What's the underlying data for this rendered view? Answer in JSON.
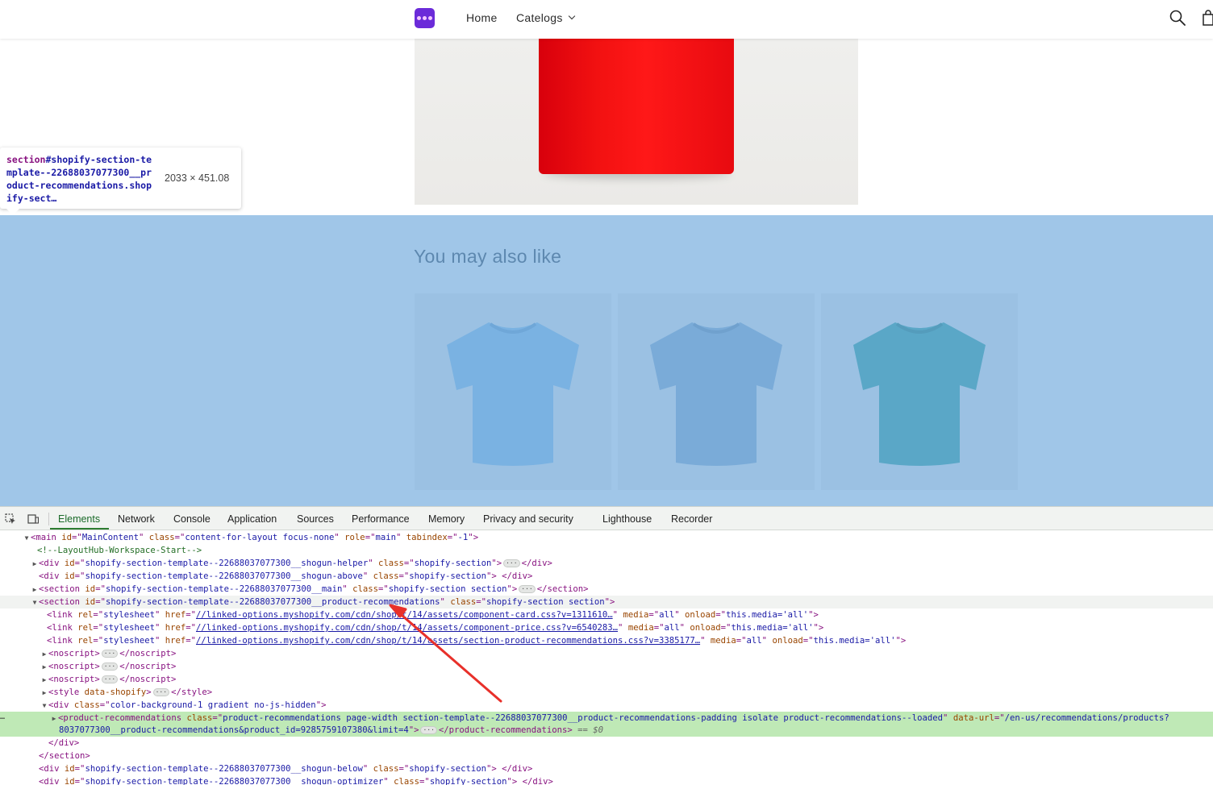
{
  "header": {
    "nav_home": "Home",
    "nav_catalog": "Catelogs"
  },
  "inspector_tooltip": {
    "tag": "section",
    "selector": "#shopify-section-template--22688037077300__product-recommendations.shopify-sect…",
    "dimensions": "2033 × 451.08"
  },
  "recommendations": {
    "title": "You may also like",
    "products": [
      {
        "color": "#8fc3ec"
      },
      {
        "color": "#8fb0cf"
      },
      {
        "color": "#33a49e"
      }
    ]
  },
  "devtools": {
    "tabs": [
      "Elements",
      "Network",
      "Console",
      "Application",
      "Sources",
      "Performance",
      "Memory",
      "Privacy and security",
      "Lighthouse",
      "Recorder"
    ],
    "active_tab": "Elements",
    "selected_suffix": "== $0",
    "dom": {
      "main_open": {
        "tag": "main",
        "attrs": [
          [
            "id",
            "MainContent"
          ],
          [
            "class",
            "content-for-layout focus-none"
          ],
          [
            "role",
            "main"
          ],
          [
            "tabindex",
            "-1"
          ]
        ]
      },
      "comment": "<!--LayoutHub-Workspace-Start-->",
      "helper_div": {
        "tag": "div",
        "id": "shopify-section-template--22688037077300__shogun-helper",
        "class": "shopify-section"
      },
      "above_div": {
        "tag": "div",
        "id": "shopify-section-template--22688037077300__shogun-above",
        "class": "shopify-section"
      },
      "main_section": {
        "tag": "section",
        "id": "shopify-section-template--22688037077300__main",
        "class": "shopify-section section"
      },
      "recs_section": {
        "tag": "section",
        "id": "shopify-section-template--22688037077300__product-recommendations",
        "class": "shopify-section section"
      },
      "links": [
        {
          "href": "//linked-options.myshopify.com/cdn/shop/t/14/assets/component-card.css?v=1311610…",
          "media": "all",
          "onload": "this.media='all'"
        },
        {
          "href": "//linked-options.myshopify.com/cdn/shop/t/14/assets/component-price.css?v=6540283…",
          "media": "all",
          "onload": "this.media='all'"
        },
        {
          "href": "//linked-options.myshopify.com/cdn/shop/t/14/assets/section-product-recommendations.css?v=3385177…",
          "media": "all",
          "onload": "this.media='all'"
        }
      ],
      "style_attr": "data-shopify",
      "color_div_class": "color-background-1 gradient no-js-hidden",
      "product_recs": {
        "class": "product-recommendations page-width section-template--22688037077300__product-recommendations-padding isolate product-recommendations--loaded",
        "data_url_line1": "/en-us/recommendations/products?",
        "data_url_line2": "8037077300__product-recommendations&product_id=9285759107380&limit=4"
      },
      "below_div": {
        "id": "shopify-section-template--22688037077300__shogun-below",
        "class": "shopify-section"
      },
      "optimizer_div": {
        "id": "shopify-section-template--22688037077300__shogun-optimizer",
        "class": "shopify-section"
      }
    }
  },
  "colors": {
    "highlight_overlay": "#6fa8dc",
    "selected_row": "#bfe9b6",
    "annotation_arrow": "#e8302a",
    "hero_product": "#f21111"
  }
}
